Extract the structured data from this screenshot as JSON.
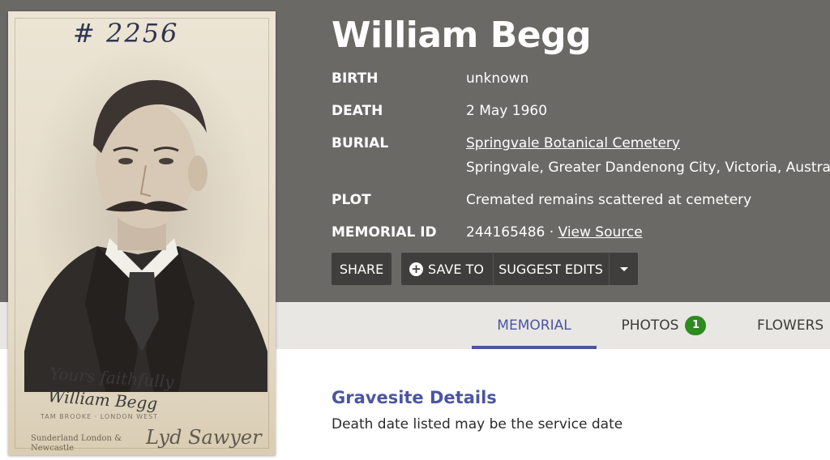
{
  "person": {
    "name": "William Begg"
  },
  "details": {
    "birth_label": "BIRTH",
    "birth_value": "unknown",
    "death_label": "DEATH",
    "death_value": "2 May 1960",
    "burial_label": "BURIAL",
    "burial_cemetery": "Springvale Botanical Cemetery",
    "burial_location": "Springvale, Greater Dandenong City, Victoria, Australia",
    "plot_label": "PLOT",
    "plot_value": "Cremated remains scattered at cemetery",
    "memorial_id_label": "MEMORIAL ID",
    "memorial_id_value": "244165486",
    "separator": "·",
    "view_source_label": "View Source"
  },
  "actions": {
    "share_label": "SHARE",
    "save_label": "SAVE TO",
    "suggest_label": "SUGGEST EDITS"
  },
  "tabs": [
    {
      "label": "MEMORIAL",
      "active": true
    },
    {
      "label": "PHOTOS",
      "badge": "1"
    },
    {
      "label": "FLOWERS",
      "badge": ""
    }
  ],
  "gravesite": {
    "title": "Gravesite Details",
    "text": "Death date listed may be the service date"
  },
  "photo": {
    "handwritten_number": "# 2256",
    "signature": "Yours faithfully William Begg",
    "studio_name": "Lyd Sawyer",
    "studio_left": "Sunderland London & Newcastle",
    "studio_line": "TAM BROOKE · LONDON WEST"
  },
  "colors": {
    "header_bg": "#6a6966",
    "button_bg": "#3f3e3c",
    "accent": "#4b55a0",
    "badge_green": "#2f8a1f",
    "tabbar_bg": "#e9e7e3"
  },
  "icons": {
    "save": "plus-circle-icon",
    "dropdown": "caret-down-icon"
  }
}
